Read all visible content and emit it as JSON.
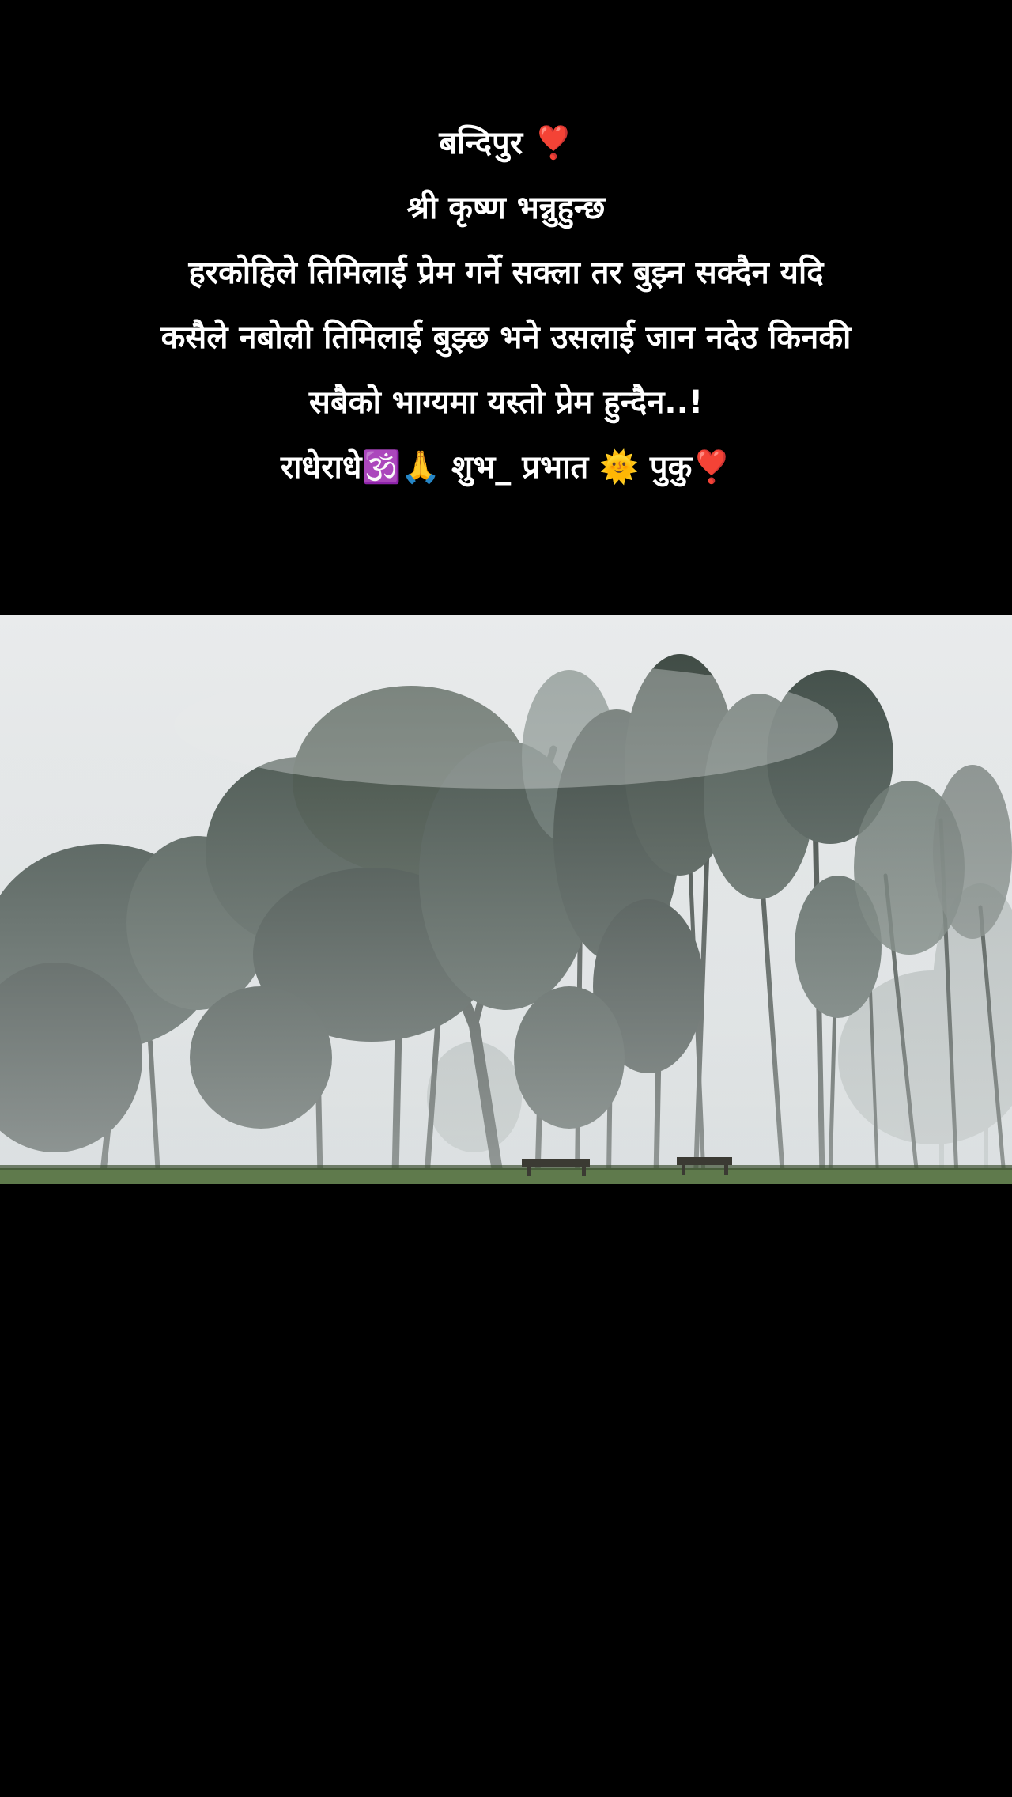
{
  "caption": {
    "lines": [
      "बन्दिपुर ❣️",
      "श्री कृष्ण भन्नुहुन्छ",
      "हरकोहिले तिमिलाई प्रेम गर्ने सक्ला तर बुझ्न सक्दैन यदि",
      "कसैले नबोली तिमिलाई बुझ्छ भने उसलाई जान नदेउ किनकी",
      "सबैको भाग्यमा यस्तो प्रेम हुन्दैन..!",
      "राधेराधे🕉️🙏 शुभ_ प्रभात 🌞 पुकु❣️"
    ]
  },
  "photo": {
    "subject": "misty tall trees over a grassy park with wooden benches",
    "colors": {
      "sky": "#e3e6e8",
      "mist": "#cfd4d6",
      "trees_dark": "#2b3530",
      "trees_mid": "#3f4b45",
      "trees_far": "#8d9794",
      "grass": "#5f7a4c"
    }
  }
}
